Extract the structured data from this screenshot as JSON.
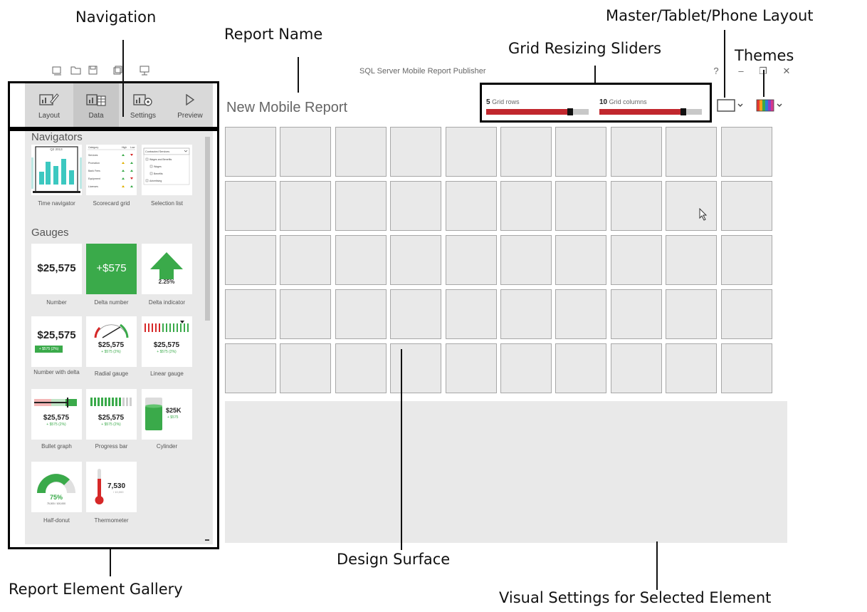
{
  "annotations": {
    "navigation": "Navigation",
    "report_name": "Report Name",
    "grid_resizing_sliders": "Grid Resizing Sliders",
    "layout": "Master/Tablet/Phone Layout",
    "themes": "Themes",
    "design_surface": "Design Surface",
    "gallery": "Report Element Gallery",
    "visual_settings": "Visual Settings for Selected Element"
  },
  "window": {
    "title": "SQL Server Mobile Report Publisher",
    "help": "?",
    "minimize": "–",
    "restore": "❐",
    "close": "✕"
  },
  "nav": {
    "layout": "Layout",
    "data": "Data",
    "settings": "Settings",
    "preview": "Preview"
  },
  "gallery": {
    "navigators_title": "Navigators",
    "gauges_title": "Gauges",
    "navigators": {
      "time_navigator": "Time navigator",
      "scorecard_grid": "Scorecard grid",
      "selection_list": "Selection list",
      "time_label": "Q2 2013",
      "scorecard_headers": [
        "Category",
        "High",
        "Low"
      ],
      "scorecard_rows": [
        "Services",
        "Promotion",
        "Bank Fees",
        "Equipment",
        "Licenses"
      ],
      "selection_dropdown": "Contracted Services",
      "selection_items": [
        "Wages and Benefits",
        "Wages",
        "Benefits",
        "Advertising"
      ]
    },
    "gauges": {
      "number": "Number",
      "number_value": "$25,575",
      "delta_number": "Delta number",
      "delta_value": "+$575",
      "delta_indicator": "Delta indicator",
      "delta_indicator_value": "2.25%",
      "number_with_delta": "Number with delta",
      "number_with_delta_value": "$25,575",
      "number_with_delta_badge": "+ $575 (2%)",
      "radial_gauge": "Radial gauge",
      "radial_value": "$25,575",
      "radial_delta": "+ $575 (2%)",
      "linear_gauge": "Linear gauge",
      "linear_value": "$25,575",
      "linear_delta": "+ $575 (2%)",
      "bullet_graph": "Bullet graph",
      "bullet_value": "$25,575",
      "bullet_delta": "+ $575 (2%)",
      "progress_bar": "Progress bar",
      "progress_value": "$25,575",
      "progress_delta": "+ $575 (2%)",
      "cylinder": "Cylinder",
      "cylinder_value": "$25K",
      "cylinder_delta": "+ $575",
      "half_donut": "Half-donut",
      "half_donut_value": "75%",
      "half_donut_sub": "75,000 / 100,000",
      "thermometer": "Thermometer",
      "thermometer_value": "7,530",
      "thermometer_sub": "/ 10,000"
    }
  },
  "report": {
    "name": "New Mobile Report"
  },
  "sliders": {
    "rows_value": "5",
    "rows_label": "Grid rows",
    "rows_level": 0.85,
    "cols_value": "10",
    "cols_label": "Grid columns",
    "cols_level": 0.85
  },
  "design_grid": {
    "rows": 5,
    "cols": 10
  },
  "colors": {
    "accent_red": "#c1272d",
    "gauge_green": "#3aaa4a",
    "teal": "#3cc8c0"
  }
}
